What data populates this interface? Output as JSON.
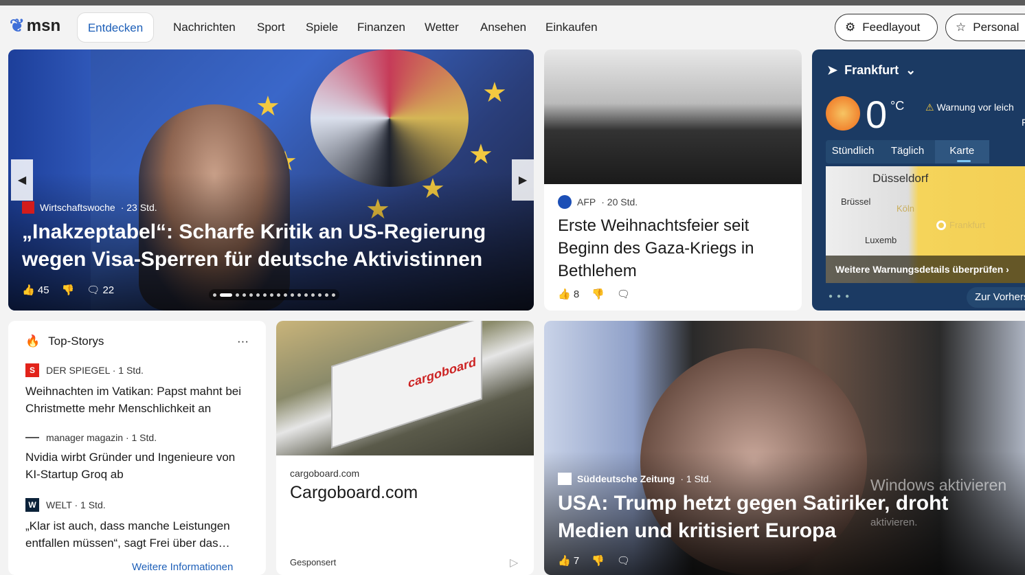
{
  "nav": {
    "logo": "msn",
    "items": [
      "Entdecken",
      "Nachrichten",
      "Sport",
      "Spiele",
      "Finanzen",
      "Wetter",
      "Ansehen",
      "Einkaufen"
    ],
    "feedlayout": "Feedlayout",
    "personal": "Personal"
  },
  "hero": {
    "source": "Wirtschaftswoche",
    "time": "· 23 Std.",
    "title": "„Inakzeptabel“: Scharfe Kritik an US-Regierung wegen Visa-Sperren für deutsche Aktivistinnen",
    "likes": "45",
    "comments": "22"
  },
  "afp": {
    "source": "AFP",
    "time": "· 20 Std.",
    "title": "Erste Weihnachtsfeier seit Beginn des Gaza-Kriegs in Bethlehem",
    "likes": "8"
  },
  "weather": {
    "city": "Frankfurt",
    "temp": "0",
    "unit": "°C",
    "warning": "Warnung vor leich",
    "warning2": "F",
    "tabs": [
      "Stündlich",
      "Täglich",
      "Karte"
    ],
    "map_labels": [
      "Düsseldorf",
      "Brüssel",
      "Köln",
      "Frankfurt",
      "Luxemb"
    ],
    "details": "Weitere Warnungsdetails überprüfen",
    "forecast": "Zur Vorhers"
  },
  "top": {
    "title": "Top-Storys",
    "more": "···",
    "items": [
      {
        "source": "DER SPIEGEL · 1 Std.",
        "title": "Weihnachten im Vatikan: Papst mahnt bei Christmette mehr Menschlichkeit an"
      },
      {
        "source": "manager magazin · 1 Std.",
        "title": "Nvidia wirbt Gründer und Ingenieure von KI-Startup Groq ab"
      },
      {
        "source": "WELT · 1 Std.",
        "title": "„Klar ist auch, dass manche Leistungen entfallen müssen“, sagt Frei über das…"
      }
    ],
    "link": "Weitere Informationen"
  },
  "cargo": {
    "domain": "cargoboard.com",
    "title": "Cargoboard.com",
    "sponsored": "Gesponsert",
    "truck_text": "cargoboard"
  },
  "sz": {
    "source": "Süddeutsche Zeitung",
    "time": "· 1 Std.",
    "title": "USA: Trump hetzt gegen Satiriker, droht Medien und kritisiert Europa",
    "likes": "7"
  },
  "watermark": {
    "line1": "Windows aktivieren",
    "line2": "aktivieren."
  },
  "colors": {
    "accent": "#1d5fb8",
    "weather_bg": "#1b3a63"
  }
}
